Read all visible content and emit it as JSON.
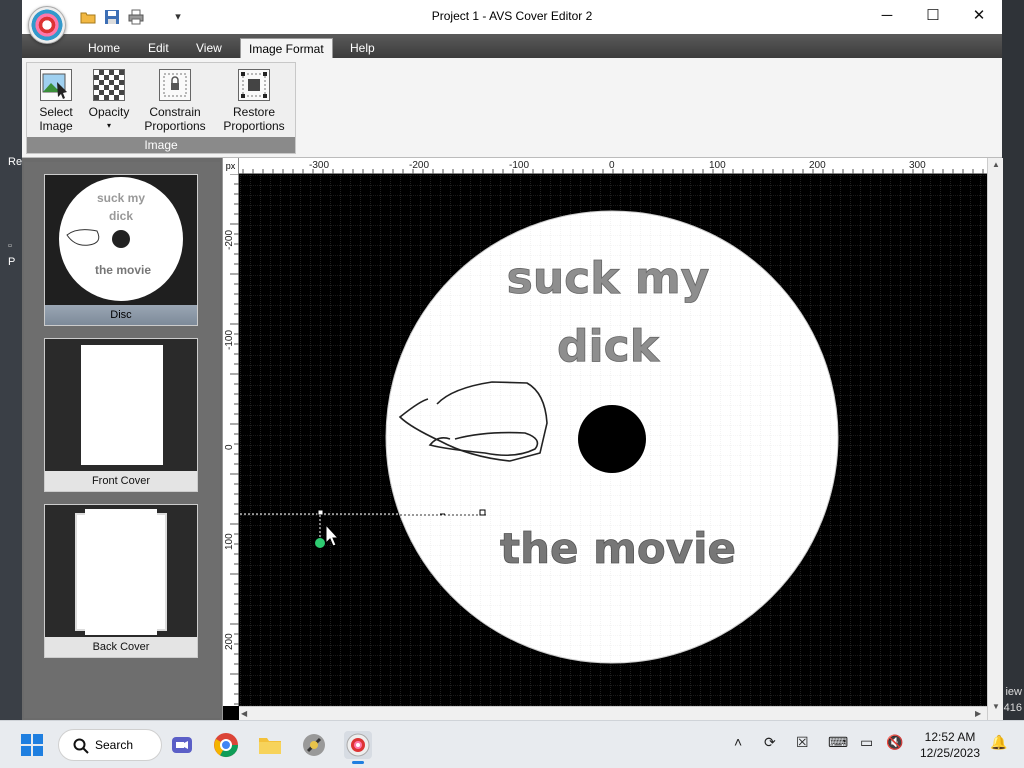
{
  "window": {
    "title": "Project 1 - AVS Cover Editor 2",
    "controls": {
      "minimize": "─",
      "maximize": "☐",
      "close": "✕"
    },
    "quick_access_more": "▾"
  },
  "menu": {
    "items": [
      "Home",
      "Edit",
      "View",
      "Image Format",
      "Help"
    ],
    "active": "Image Format"
  },
  "ribbon": {
    "group_label": "Image",
    "buttons": [
      {
        "line1": "Select",
        "line2": "Image"
      },
      {
        "line1": "Opacity",
        "line2": "▾"
      },
      {
        "line1": "Constrain",
        "line2": "Proportions"
      },
      {
        "line1": "Restore",
        "line2": "Proportions"
      }
    ]
  },
  "thumbnails": [
    {
      "label": "Disc",
      "selected": true,
      "text_top_1": "suck my",
      "text_top_2": "dick",
      "text_bottom": "the movie"
    },
    {
      "label": "Front Cover",
      "selected": false
    },
    {
      "label": "Back Cover",
      "selected": false
    }
  ],
  "ruler": {
    "unit": "px",
    "h_ticks": [
      "-300",
      "-200",
      "-100",
      "0",
      "100",
      "200",
      "300"
    ],
    "v_ticks": [
      "-200",
      "-100",
      "0",
      "100",
      "200"
    ]
  },
  "disc": {
    "text_line1": "suck my",
    "text_line2": "dick",
    "text_line3": "the movie"
  },
  "desktop": {
    "left_fragments": [
      "Re",
      "P"
    ],
    "right_fragments": [
      "iew",
      "416"
    ]
  },
  "taskbar": {
    "search_label": "Search",
    "time": "12:52 AM",
    "date": "12/25/2023"
  },
  "colors": {
    "title_bg": "#ffffff",
    "menubar_bg": "#4a4a4a",
    "disc_fill": "#ffffff",
    "disc_text": "#8c8c8c",
    "selection_handle": "#2ecc71"
  }
}
